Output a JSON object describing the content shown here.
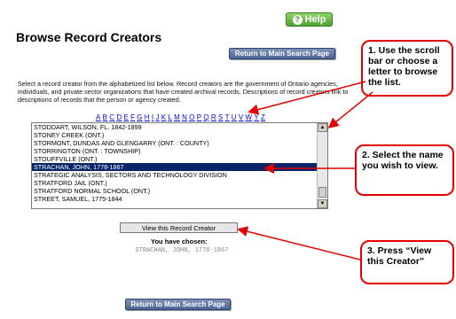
{
  "help_button": {
    "label": "Help",
    "icon": "question-icon"
  },
  "page_title": "Browse Record Creators",
  "return_top_label": "Return to Main Search Page",
  "return_bottom_label": "Return to Main Search Page",
  "intro_text": "Select a record creator from the alphabetized list below. Record creators are the government of Ontario agencies, individuals, and private sector organizations that have created archival records. Descriptions of record creators link to descriptions of records that the person or agency created.",
  "alphabet": [
    "A",
    "B",
    "C",
    "D",
    "E",
    "F",
    "G",
    "H",
    "I",
    "J",
    "K",
    "L",
    "M",
    "N",
    "O",
    "P",
    "Q",
    "R",
    "S",
    "T",
    "U",
    "V",
    "W",
    "Y",
    "Z"
  ],
  "record_list": {
    "items": [
      "STODDART, WILSON, FL. 1842-1899",
      "STONEY CREEK (ONT.)",
      "STORMONT, DUNDAS AND GLENGARRY (ONT. : COUNTY)",
      "STORRINGTON (ONT. : TOWNSHIP)",
      "STOUFFVILLE (ONT.)",
      "STRACHAN, JOHN, 1778-1867",
      "STRATEGIC ANALYSIS, SECTORS AND TECHNOLOGY DIVISION",
      "STRATFORD JAIL (ONT.)",
      "STRATFORD NORMAL SCHOOL (ONT.)",
      "STREET, SAMUEL, 1775-1844"
    ],
    "selected_index": 5
  },
  "view_button_label": "View this Record Creator",
  "chosen_label": "You have chosen:",
  "chosen_value": "STRACHAN, JOHN, 1778-1867",
  "callouts": {
    "step1": "1. Use the scroll bar or choose a letter to browse the list.",
    "step2": "2. Select the name you wish to view.",
    "step3": "3. Press “View this Creator”"
  },
  "colors": {
    "accent_red": "#e40000",
    "selection": "#0a246a",
    "help_green": "#4fa233",
    "nav_blue": "#4b6595"
  }
}
